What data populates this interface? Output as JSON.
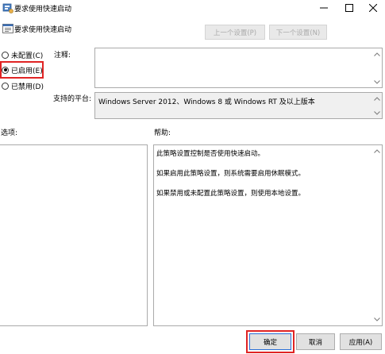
{
  "window": {
    "title": "要求使用快速启动",
    "minimize_icon": "minimize-icon",
    "maximize_icon": "maximize-icon",
    "close_icon": "close-icon"
  },
  "header": {
    "policy_name": "要求使用快速启动",
    "prev_label": "上一个设置(P)",
    "next_label": "下一个设置(N)"
  },
  "state": {
    "not_configured": "未配置(C)",
    "enabled": "已启用(E)",
    "disabled": "已禁用(D)",
    "selected": "enabled"
  },
  "comment": {
    "label": "注释:",
    "value": ""
  },
  "platform": {
    "label": "支持的平台:",
    "value": "Windows Server 2012、Windows 8 或 Windows RT 及以上版本"
  },
  "options": {
    "label": "选项:"
  },
  "help": {
    "label": "帮助:",
    "lines": [
      "此策略设置控制是否使用快速启动。",
      "如果启用此策略设置，则系统需要启用休眠模式。",
      "如果禁用或未配置此策略设置，则使用本地设置。"
    ]
  },
  "buttons": {
    "ok": "确定",
    "cancel": "取消",
    "apply": "应用(A)"
  },
  "colors": {
    "highlight": "#e02424",
    "ok_border": "#2a6fd6"
  }
}
